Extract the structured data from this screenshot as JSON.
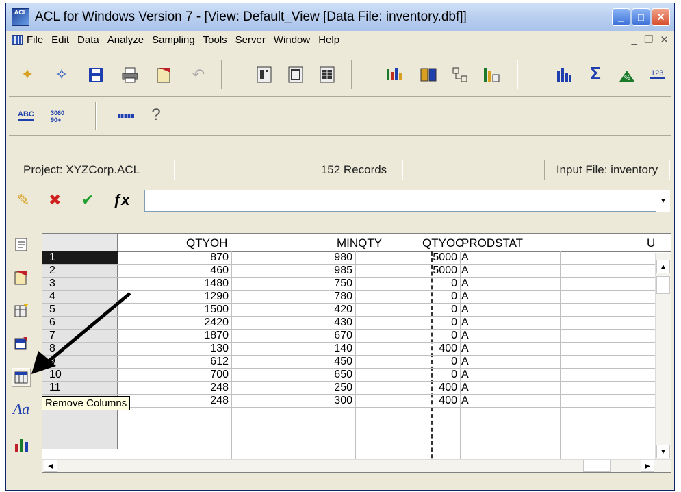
{
  "window": {
    "title": "ACL for Windows Version 7 - [View: Default_View [Data File: inventory.dbf]]",
    "app_icon_text": "ACL",
    "controls": {
      "minimize": "_",
      "maximize": "□",
      "close": "✕"
    },
    "mdi_controls": {
      "minimize": "_",
      "restore": "❐",
      "close": "✕"
    }
  },
  "menubar": {
    "items": [
      "File",
      "Edit",
      "Data",
      "Analyze",
      "Sampling",
      "Tools",
      "Server",
      "Window",
      "Help"
    ]
  },
  "status": {
    "project": "Project: XYZCorp.ACL",
    "records": "152 Records",
    "input_file": "Input File: inventory"
  },
  "filter": {
    "value": "",
    "placeholder": ""
  },
  "table": {
    "columns": [
      "QTYOH",
      "MINQTY",
      "QTYOO",
      "PRODSTAT",
      "U"
    ],
    "rows": [
      {
        "n": "1",
        "qtyoh": "870",
        "minqty": "980",
        "qtyoo": "5000",
        "prodstat": "A"
      },
      {
        "n": "2",
        "qtyoh": "460",
        "minqty": "985",
        "qtyoo": "5000",
        "prodstat": "A"
      },
      {
        "n": "3",
        "qtyoh": "1480",
        "minqty": "750",
        "qtyoo": "0",
        "prodstat": "A"
      },
      {
        "n": "4",
        "qtyoh": "1290",
        "minqty": "780",
        "qtyoo": "0",
        "prodstat": "A"
      },
      {
        "n": "5",
        "qtyoh": "1500",
        "minqty": "420",
        "qtyoo": "0",
        "prodstat": "A"
      },
      {
        "n": "6",
        "qtyoh": "2420",
        "minqty": "430",
        "qtyoo": "0",
        "prodstat": "A"
      },
      {
        "n": "7",
        "qtyoh": "1870",
        "minqty": "670",
        "qtyoo": "0",
        "prodstat": "A"
      },
      {
        "n": "8",
        "qtyoh": "130",
        "minqty": "140",
        "qtyoo": "400",
        "prodstat": "A"
      },
      {
        "n": "9",
        "qtyoh": "612",
        "minqty": "450",
        "qtyoo": "0",
        "prodstat": "A"
      },
      {
        "n": "10",
        "qtyoh": "700",
        "minqty": "650",
        "qtyoo": "0",
        "prodstat": "A"
      },
      {
        "n": "11",
        "qtyoh": "248",
        "minqty": "250",
        "qtyoo": "400",
        "prodstat": "A"
      },
      {
        "n": "12",
        "qtyoh": "248",
        "minqty": "300",
        "qtyoo": "400",
        "prodstat": "A"
      }
    ]
  },
  "tooltip": {
    "text": "Remove Columns"
  },
  "colors": {
    "chrome": "#ece9d8",
    "title_gradient_top": "#cfe0f8",
    "selected_row": "#1a1a1a",
    "tooltip_bg": "#ffffe1"
  },
  "icons": {
    "toolbar1": [
      "open-project-icon",
      "close-project-icon",
      "save-icon",
      "print-icon",
      "export-icon",
      "undo-icon",
      "view-left-icon",
      "view-center-icon",
      "view-grid-icon",
      "stratify-icon",
      "classify-icon",
      "relate-icon",
      "join-icon",
      "statistics-icon",
      "total-icon",
      "percent-icon",
      "count-icon"
    ],
    "toolbar2": [
      "abc-icon",
      "numeric-format-icon",
      "ruler-icon",
      "help-icon"
    ],
    "filter": [
      "edit-filter-icon",
      "remove-filter-icon",
      "apply-filter-icon",
      "expression-icon"
    ],
    "side": [
      "notes-icon",
      "export-view-icon",
      "add-columns-icon",
      "modify-columns-icon",
      "remove-columns-icon",
      "font-icon",
      "graph-icon"
    ]
  }
}
